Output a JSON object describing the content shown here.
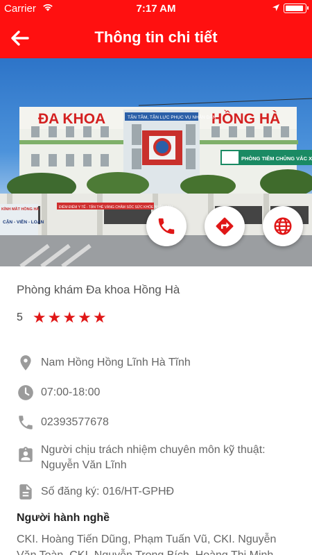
{
  "status_bar": {
    "carrier": "Carrier",
    "time": "7:17 AM"
  },
  "header": {
    "title": "Thông tin chi tiết"
  },
  "photo": {
    "sign_left": "ĐA KHOA",
    "sign_right": "HỒNG HÀ",
    "slogan": "TẬN TÂM, TẬN LỰC PHỤC VỤ NHÂN DÂN",
    "vaccine": "PHÒNG TIÊM CHỦNG VẮC XIN",
    "banner": "ĐIỂM ĐIỂM Y TẾ - TẬN THẺ VÀNG CHĂM SÓC SỨC KHỎE NHÂN DÂN",
    "shop_title": "KÍNH MẮT HỒNG HÀ",
    "shop_text": "CẬN - VIỄN - LOẠN"
  },
  "clinic": {
    "name": "Phòng khám Đa khoa Hồng Hà",
    "rating": "5",
    "stars": 5
  },
  "details": {
    "address": "Nam Hồng Hồng Lĩnh Hà Tĩnh",
    "hours": "07:00-18:00",
    "phone": "02393577678",
    "responsible": "Người chịu trách nhiệm chuyên môn kỹ thuật: Nguyễn Văn Lĩnh",
    "license": "Số đăng ký: 016/HT-GPHĐ"
  },
  "practitioners": {
    "heading": "Người hành nghề",
    "text": "CKI. Hoàng Tiến Dũng, Phạm Tuấn Vũ, CKI. Nguyễn Văn Toàn, CKI. Nguyễn Trọng Bích, Hoàng Thị Minh"
  },
  "colors": {
    "primary": "#ff1010",
    "icon_grey": "#9b9b9b",
    "star": "#e01717"
  }
}
